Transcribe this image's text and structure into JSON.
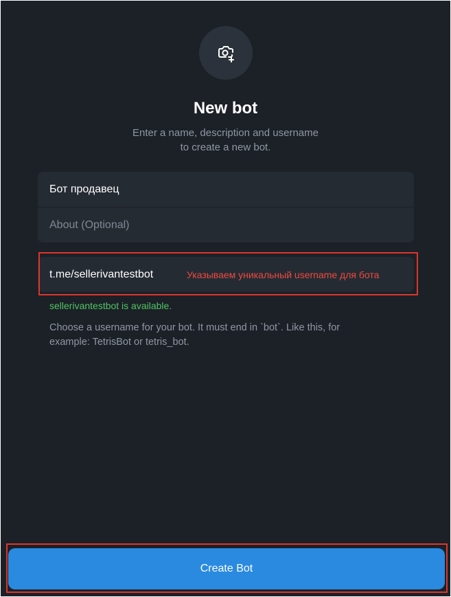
{
  "header": {
    "avatar_icon": "camera-plus-icon",
    "title": "New bot",
    "subtitle_line1": "Enter a name, description and username",
    "subtitle_line2": "to create a new bot."
  },
  "form": {
    "name_value": "Бот продавец",
    "about_placeholder": "About (Optional)",
    "username_value": "t.me/sellerivantestbot",
    "annotation": "Указываем уникальный username для бота",
    "availability": "sellerivantestbot is available.",
    "hint": "Choose a username for your bot. It must end in `bot`. Like this, for example: TetrisBot or tetris_bot."
  },
  "footer": {
    "create_label": "Create Bot"
  },
  "colors": {
    "background": "#1c2027",
    "card": "#252b33",
    "accent": "#2a8ae0",
    "success": "#4fc463",
    "annotation_red": "#e0352b"
  }
}
